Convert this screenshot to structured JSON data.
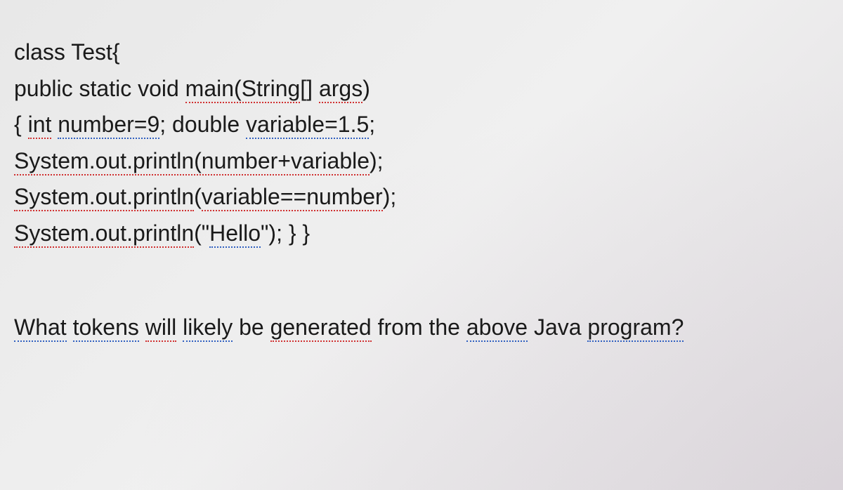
{
  "code": {
    "line1_class": "class",
    "line1_rest": " Test{",
    "line2_public": "public",
    "line2_static": "static",
    "line2_void": "void",
    "line2_main": "main(String",
    "line2_brackets": "[]",
    "line2_args": "args",
    "line2_paren": ")",
    "line3_open": "{",
    "line3_int": "int",
    "line3_num9": "number=9",
    "line3_semi1": ";",
    "line3_double": "double",
    "line3_var15": "variable=1.5",
    "line3_semi2": ";",
    "line4_sys": "System.out.println(number+variable",
    "line4_end": ");",
    "line5_sys": "System.out.println",
    "line5_mid": "(",
    "line5_var": "variable==number",
    "line5_end": ");",
    "line6_sys": "System.out.println",
    "line6_open": "(\"",
    "line6_hello": "Hello",
    "line6_close": "\");  } }"
  },
  "question": {
    "what": "What",
    "sp1": " ",
    "tokens": "tokens",
    "sp2": " ",
    "will": "will",
    "sp3": " ",
    "likely": "likely",
    "sp4": " be ",
    "generated": "generated",
    "sp5": " from the ",
    "above": "above",
    "sp6": " Java ",
    "program": "program?"
  }
}
